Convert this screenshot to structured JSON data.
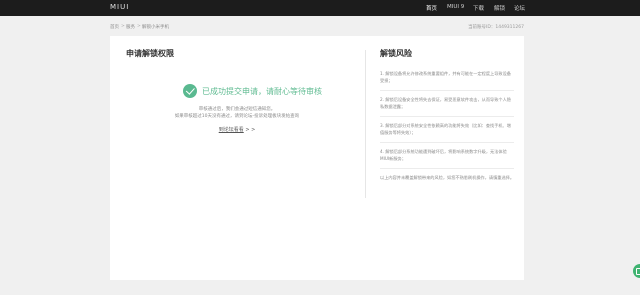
{
  "header": {
    "logo": "MIUI",
    "nav": [
      "首页",
      "MIUI 9",
      "下载",
      "解锁",
      "论坛"
    ]
  },
  "breadcrumb": {
    "items": [
      "首页",
      "服务",
      "解锁小米手机"
    ],
    "separator": ">",
    "account": "当前账号ID：1449311267"
  },
  "apply": {
    "title": "申请解锁权限",
    "success": "已成功提交申请，请耐心等待审核",
    "info1": "审核通过后，我们会通过短信通知您。",
    "info2": "如果审核超过10天没有通过，请到论坛-投诉处理板块发帖查询",
    "forum_link": "到论坛看看",
    "forum_link_suffix": "> >"
  },
  "risk": {
    "title": "解锁风险",
    "items": [
      "1. 解锁设备将允许修改系统重要组件，并有可能在一定程度上导致设备受损；",
      "2. 解锁后设备安全性将失去保证，易受恶意软件攻击，从而导致个人隐私数据泄露；",
      "3. 解锁后部分对系统安全性依赖高的功能将失效（比如：查找手机、增值服务等将失效）；",
      "4. 解锁后部分系统功能遭到破坏后，将影响系统数字升级，无法体验MIUI新服务；",
      "以上内容并未覆盖解锁带来的风险，如您不熟悉刷机操作，请慎重选择。"
    ]
  },
  "colors": {
    "accent": "#5ab990",
    "topbar": "#1c1c1c",
    "background": "#f0f0f0"
  }
}
